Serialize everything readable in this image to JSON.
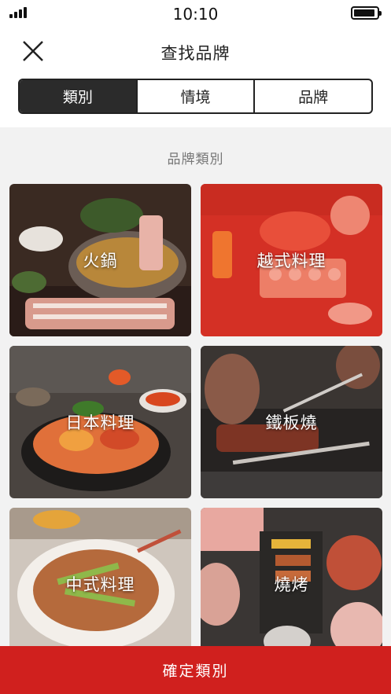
{
  "status_bar": {
    "time": "10:10"
  },
  "header": {
    "title": "查找品牌"
  },
  "tabs": [
    {
      "label": "類別",
      "active": true
    },
    {
      "label": "情境",
      "active": false
    },
    {
      "label": "品牌",
      "active": false
    }
  ],
  "section": {
    "title": "品牌類別"
  },
  "categories": [
    {
      "label": "火鍋",
      "highlighted": false
    },
    {
      "label": "越式料理",
      "highlighted": true
    },
    {
      "label": "日本料理",
      "highlighted": false
    },
    {
      "label": "鐵板燒",
      "highlighted": false
    },
    {
      "label": "中式料理",
      "highlighted": false
    },
    {
      "label": "燒烤",
      "highlighted": false
    }
  ],
  "confirm_button": {
    "label": "確定類別"
  },
  "colors": {
    "accent": "#d0201e",
    "dark": "#2b2b2b",
    "highlight_overlay": "#e8321e"
  }
}
